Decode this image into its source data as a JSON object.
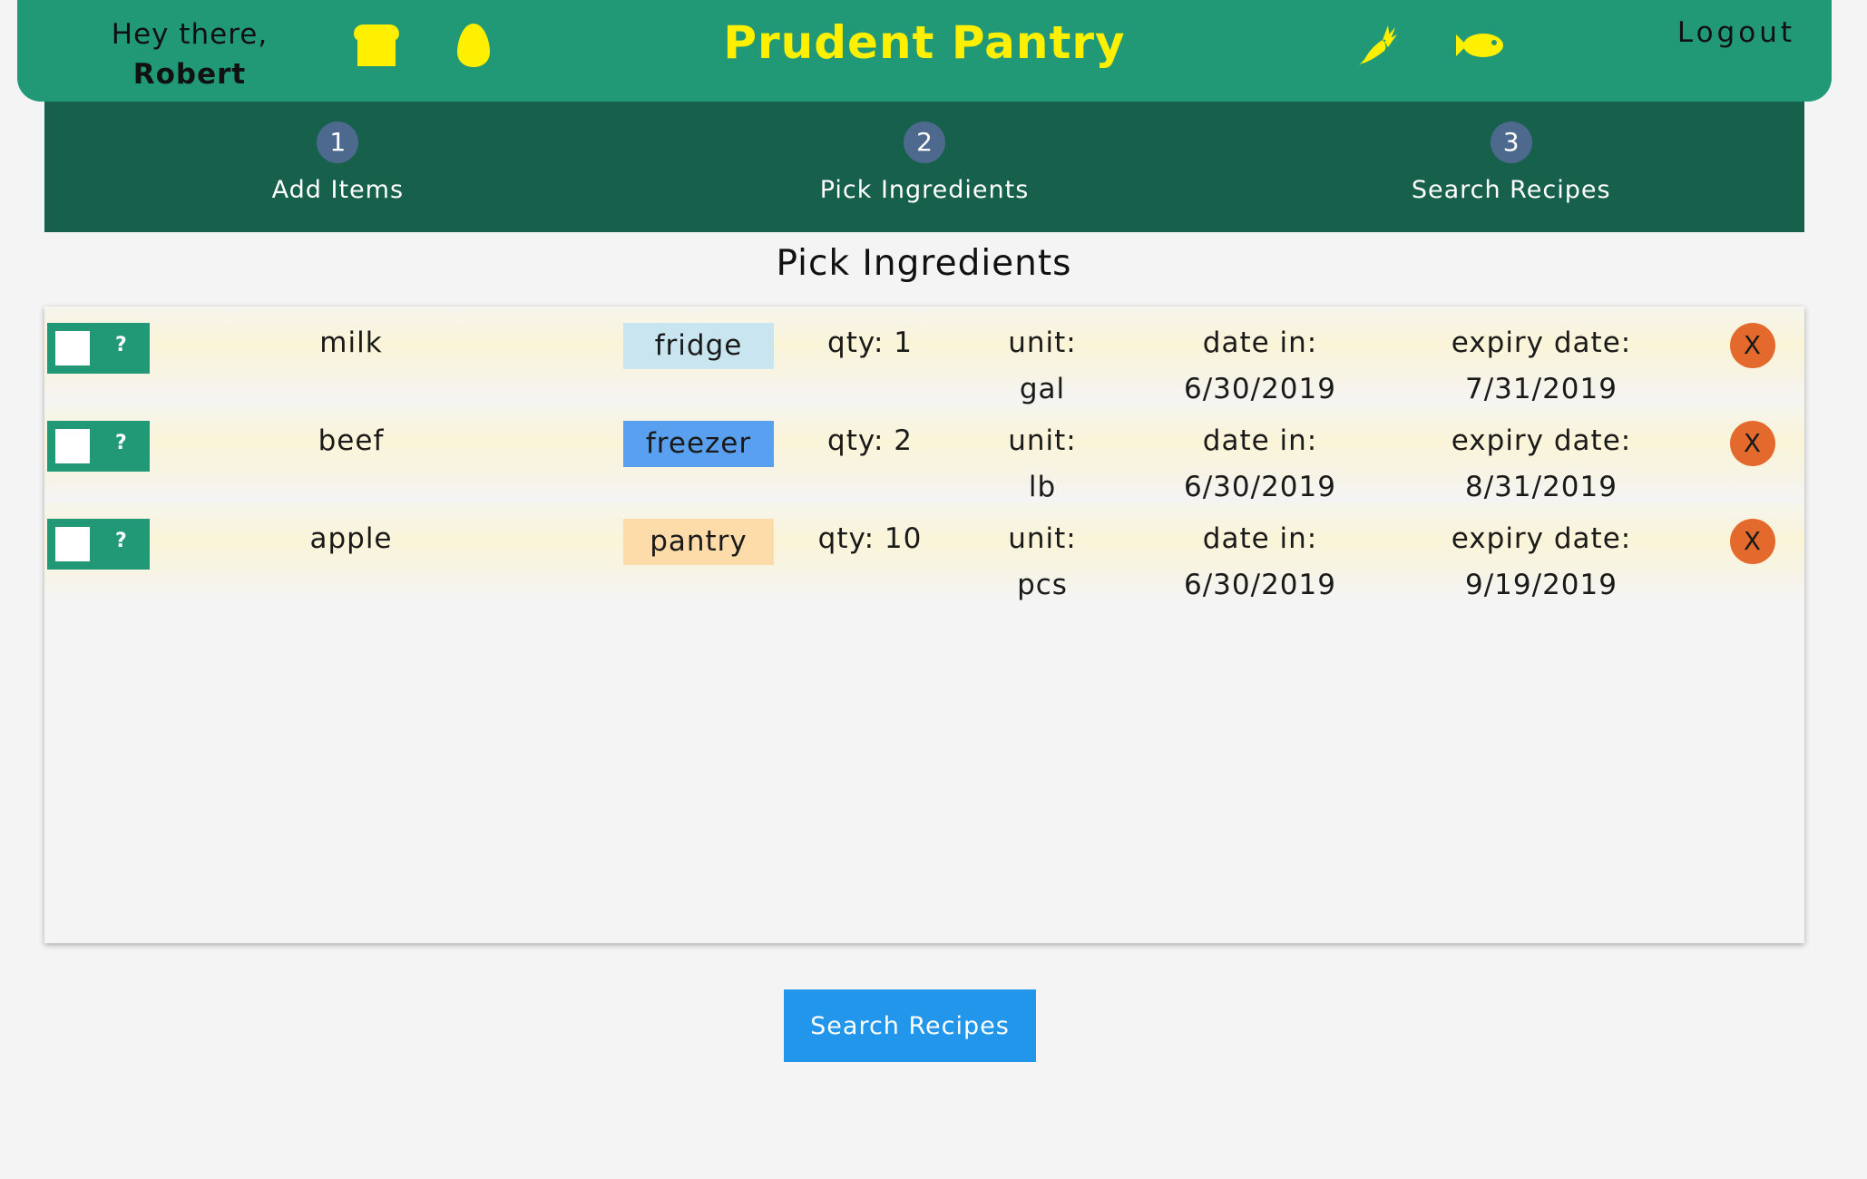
{
  "header": {
    "greeting": "Hey there,",
    "user_name": "Robert",
    "title": "Prudent Pantry",
    "logout_label": "Logout",
    "icon_color": "#ffef00",
    "icons": [
      "bread-icon",
      "egg-icon",
      "carrot-icon",
      "fish-icon"
    ]
  },
  "steps": [
    {
      "number": "1",
      "label": "Add Items"
    },
    {
      "number": "2",
      "label": "Pick Ingredients"
    },
    {
      "number": "3",
      "label": "Search Recipes"
    }
  ],
  "page_title": "Pick Ingredients",
  "items": [
    {
      "name": "milk",
      "location": "fridge",
      "location_color": "#c9e6f0",
      "qty": "qty: 1",
      "unit_label": "unit:",
      "unit": "gal",
      "date_in_label": "date in:",
      "date_in": "6/30/2019",
      "expiry_label": "expiry date:",
      "expiry": "7/31/2019",
      "toggle_hint": "?",
      "delete_label": "X"
    },
    {
      "name": "beef",
      "location": "freezer",
      "location_color": "#5aa0f0",
      "qty": "qty: 2",
      "unit_label": "unit:",
      "unit": "lb",
      "date_in_label": "date in:",
      "date_in": "6/30/2019",
      "expiry_label": "expiry date:",
      "expiry": "8/31/2019",
      "toggle_hint": "?",
      "delete_label": "X"
    },
    {
      "name": "apple",
      "location": "pantry",
      "location_color": "#fddcaa",
      "qty": "qty: 10",
      "unit_label": "unit:",
      "unit": "pcs",
      "date_in_label": "date in:",
      "date_in": "6/30/2019",
      "expiry_label": "expiry date:",
      "expiry": "9/19/2019",
      "toggle_hint": "?",
      "delete_label": "X"
    }
  ],
  "search_button_label": "Search Recipes"
}
